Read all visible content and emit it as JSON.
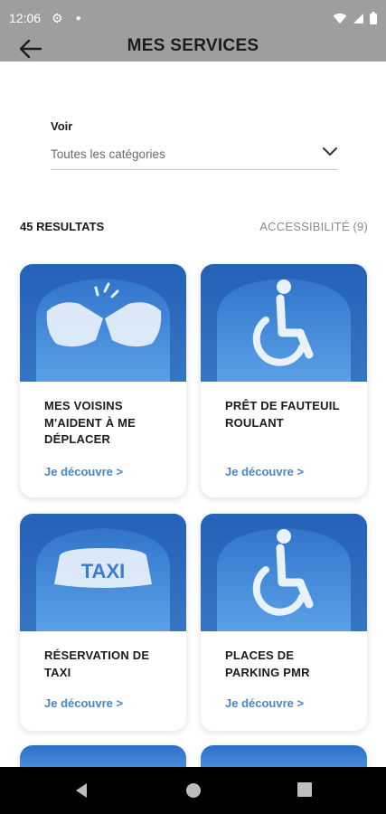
{
  "status_bar": {
    "time": "12:06"
  },
  "app_bar": {
    "title": "MES SERVICES"
  },
  "filter": {
    "label": "Voir",
    "value": "Toutes les catégories"
  },
  "results": {
    "count": "45 RESULTATS",
    "filter_tag": "ACCESSIBILITÉ (9)"
  },
  "cards": [
    {
      "title": "MES VOISINS M'AIDENT À ME DÉPLACER",
      "link": "Je découvre >",
      "icon": "helping-hands-cloud-icon"
    },
    {
      "title": "PRÊT DE FAUTEUIL ROULANT",
      "link": "Je découvre >",
      "icon": "wheelchair-cloud-icon"
    },
    {
      "title": "RÉSERVATION DE TAXI",
      "link": "Je découvre >",
      "icon": "taxi-cloud-icon",
      "image_text": "TAXI"
    },
    {
      "title": "PLACES DE PARKING PMR",
      "link": "Je découvre >",
      "icon": "wheelchair-cloud-icon"
    }
  ],
  "colors": {
    "accent_link": "#4a86c7",
    "sky_top": "#2c6fc8",
    "sky_bottom": "#5aa0e6",
    "status_bar": "#9e9e9e"
  }
}
